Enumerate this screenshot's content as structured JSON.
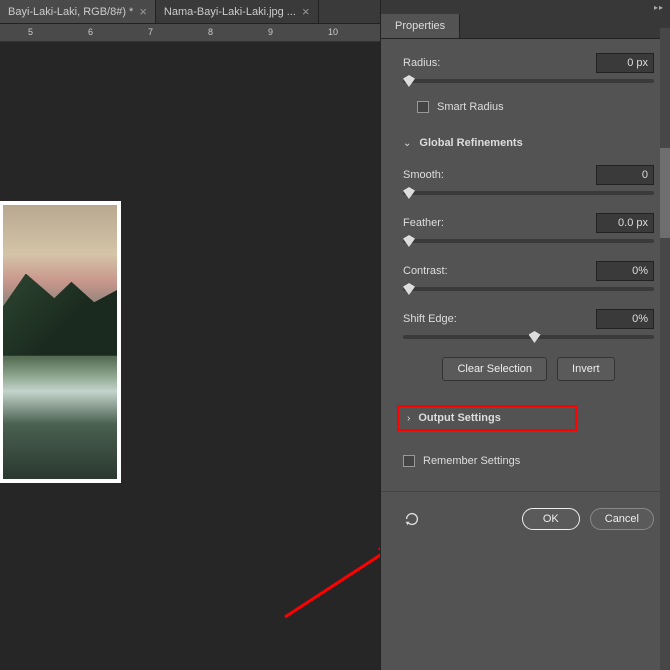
{
  "tabs": [
    {
      "label": "Bayi-Laki-Laki, RGB/8#) *"
    },
    {
      "label": "Nama-Bayi-Laki-Laki.jpg ..."
    }
  ],
  "ruler": {
    "marks": [
      5,
      6,
      7,
      8,
      9,
      10
    ]
  },
  "panel": {
    "tab": "Properties",
    "radius": {
      "label": "Radius:",
      "value": "0 px",
      "thumb": 0
    },
    "smart_radius_label": "Smart Radius",
    "global_refinements": "Global Refinements",
    "smooth": {
      "label": "Smooth:",
      "value": "0",
      "thumb": 0
    },
    "feather": {
      "label": "Feather:",
      "value": "0.0 px",
      "thumb": 0
    },
    "contrast": {
      "label": "Contrast:",
      "value": "0%",
      "thumb": 0
    },
    "shift_edge": {
      "label": "Shift Edge:",
      "value": "0%",
      "thumb": 50
    },
    "clear_selection": "Clear Selection",
    "invert": "Invert",
    "output_settings": "Output Settings",
    "remember_settings": "Remember Settings",
    "ok": "OK",
    "cancel": "Cancel"
  }
}
